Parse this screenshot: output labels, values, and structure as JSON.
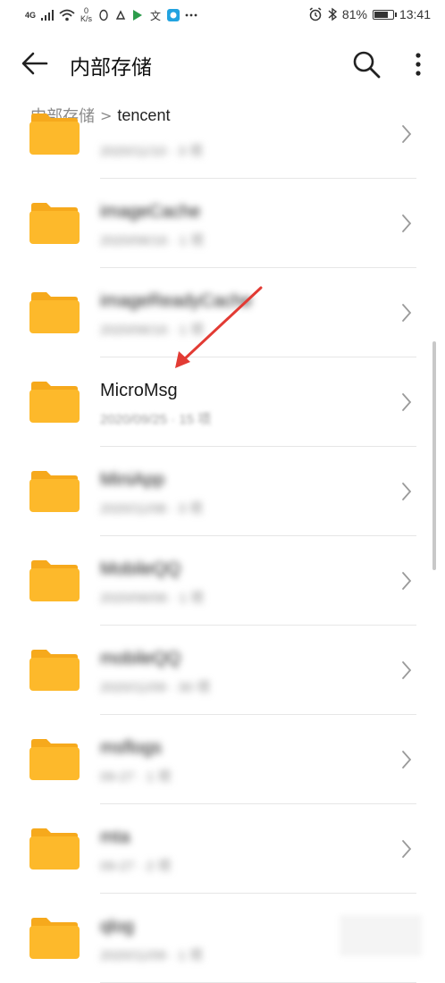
{
  "statusbar": {
    "network": "4G",
    "speed_value": "0",
    "speed_unit": "K/s",
    "battery": "81%",
    "battery_level": 0.81,
    "time": "13:41"
  },
  "toolbar": {
    "title": "内部存储"
  },
  "breadcrumb": {
    "root": "内部存储",
    "separator": ">",
    "current": "tencent"
  },
  "folders": [
    {
      "name": "",
      "meta": "2020/11/10 · 3 项",
      "blurred": true
    },
    {
      "name": "imageCache",
      "meta": "2020/06/16 · 1 项",
      "blurred": true
    },
    {
      "name": "imageReadyCache",
      "meta": "2020/06/16 · 1 项",
      "blurred": true
    },
    {
      "name": "MicroMsg",
      "meta": "2020/09/25 · 15 项",
      "blurred": false
    },
    {
      "name": "MiniApp",
      "meta": "2020/11/08 · 3 项",
      "blurred": true
    },
    {
      "name": "MobileQQ",
      "meta": "2020/06/06 · 1 项",
      "blurred": true
    },
    {
      "name": "mobileQQ",
      "meta": "2020/11/09 · 30 项",
      "blurred": true
    },
    {
      "name": "msflogs",
      "meta": "09-27 · 1 项",
      "blurred": true
    },
    {
      "name": "mta",
      "meta": "09-27 · 2 项",
      "blurred": true
    },
    {
      "name": "qlog",
      "meta": "2020/11/09 · 1 项",
      "blurred": true
    }
  ],
  "colors": {
    "folder": "#FDB92B",
    "folder_dark": "#F6A91C",
    "arrow": "#E23B34"
  }
}
